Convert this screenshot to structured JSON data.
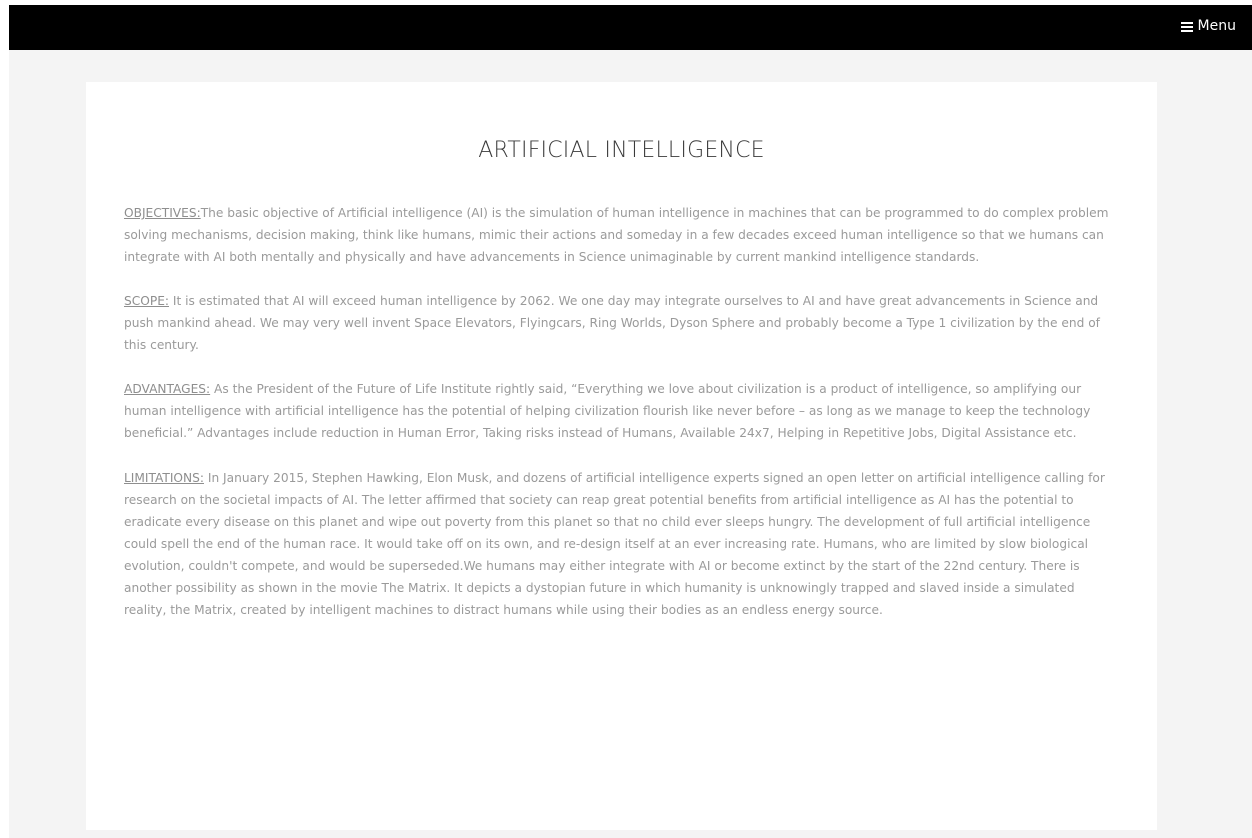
{
  "header": {
    "menu_label": "Menu",
    "menu_icon": "hamburger-icon"
  },
  "page": {
    "title": "ARTIFICIAL INTELLIGENCE"
  },
  "sections": [
    {
      "label": "OBJECTIVES:",
      "text": "The basic objective of Artificial intelligence (AI) is the simulation of human intelligence in machines that can be programmed to do complex problem solving mechanisms, decision making, think like humans, mimic their actions and someday in a few decades exceed human intelligence so that we humans can integrate with AI both mentally and physically and have advancements in Science unimaginable by current mankind intelligence standards."
    },
    {
      "label": "SCOPE:",
      "text": " It is estimated that AI will exceed human intelligence by 2062. We one day may integrate ourselves to AI and have great advancements in Science and push mankind ahead. We may very well invent Space Elevators, Flyingcars, Ring Worlds, Dyson Sphere and probably become a Type 1 civilization by the end of this century."
    },
    {
      "label": "ADVANTAGES:",
      "text": " As the President of the Future of Life Institute rightly said, “Everything we love about civilization is a product of intelligence, so amplifying our human intelligence with artificial intelligence has the potential of helping civilization flourish like never before – as long as we manage to keep the technology beneficial.” Advantages include reduction in Human Error, Taking risks instead of Humans, Available 24x7, Helping in Repetitive Jobs, Digital Assistance etc."
    },
    {
      "label": "LIMITATIONS:",
      "text": " In January 2015, Stephen Hawking, Elon Musk, and dozens of artificial intelligence experts signed an open letter on artificial intelligence calling for research on the societal impacts of AI. The letter affirmed that society can reap great potential benefits from artificial intelligence as AI has the potential to eradicate every disease on this planet and wipe out poverty from this planet so that no child ever sleeps hungry. The development of full artificial intelligence could spell the end of the human race. It would take off on its own, and re-design itself at an ever increasing rate. Humans, who are limited by slow biological evolution, couldn't compete, and would be superseded.We humans may either integrate with AI or become extinct by the start of the 22nd century. There is another possibility as shown in the movie The Matrix. It depicts a dystopian future in which humanity is unknowingly trapped and slaved inside a simulated reality, the Matrix, created by intelligent machines to distract humans while using their bodies as an endless energy source."
    }
  ],
  "colors": {
    "topbar": "#000000",
    "page_background": "#f4f4f4",
    "card_background": "#ffffff",
    "title_text": "#3a3a3a",
    "body_text": "#9a9a9a"
  }
}
